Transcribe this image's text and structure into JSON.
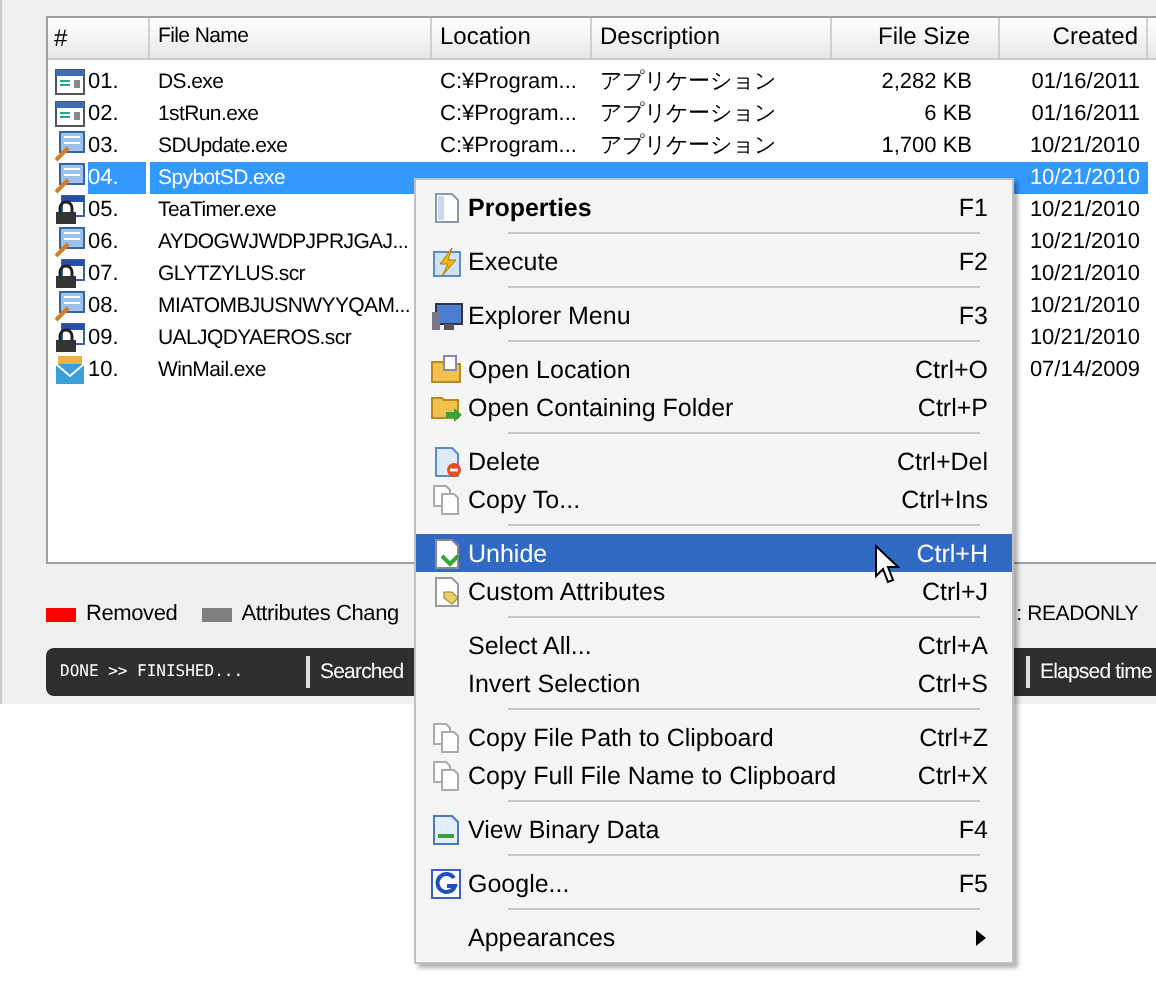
{
  "table": {
    "columns": [
      "#",
      "File Name",
      "Location",
      "Description",
      "File Size",
      "Created"
    ],
    "rows": [
      {
        "kind": "app",
        "num": "01.",
        "name": "DS.exe",
        "location": "C:¥Program...",
        "description": "アプリケーション",
        "size": "2,282 KB",
        "created": "01/16/2011",
        "selected": false
      },
      {
        "kind": "app",
        "num": "02.",
        "name": "1stRun.exe",
        "location": "C:¥Program...",
        "description": "アプリケーション",
        "size": "6 KB",
        "created": "01/16/2011",
        "selected": false
      },
      {
        "kind": "installer",
        "num": "03.",
        "name": "SDUpdate.exe",
        "location": "C:¥Program...",
        "description": "アプリケーション",
        "size": "1,700 KB",
        "created": "10/21/2010",
        "selected": false
      },
      {
        "kind": "installer",
        "num": "04.",
        "name": "SpybotSD.exe",
        "created": "10/21/2010",
        "selected": true
      },
      {
        "kind": "lock",
        "num": "05.",
        "name": "TeaTimer.exe",
        "created": "10/21/2010",
        "selected": false
      },
      {
        "kind": "installer",
        "num": "06.",
        "name": "AYDOGWJWDPJPRJGAJ...",
        "created": "10/21/2010",
        "selected": false
      },
      {
        "kind": "lock",
        "num": "07.",
        "name": "GLYTZYLUS.scr",
        "created": "10/21/2010",
        "selected": false
      },
      {
        "kind": "installer",
        "num": "08.",
        "name": "MIATOMBJUSNWYYQAM...",
        "created": "10/21/2010",
        "selected": false
      },
      {
        "kind": "lock",
        "num": "09.",
        "name": "UALJQDYAEROS.scr",
        "created": "10/21/2010",
        "selected": false
      },
      {
        "kind": "mail",
        "num": "10.",
        "name": "WinMail.exe",
        "created": "07/14/2009",
        "selected": false
      }
    ]
  },
  "legend": [
    {
      "label": "Removed",
      "color": "#ff0000"
    },
    {
      "label": "Attributes Chang",
      "color": "#808080"
    }
  ],
  "legend_right": ": READONLY",
  "status_bar": [
    "DONE >> FINISHED...",
    "Searched",
    "Elapsed time"
  ],
  "context_menu": [
    {
      "kind": "default",
      "label": "Properties",
      "shortcut": "F1",
      "selected": false
    },
    {
      "kind": "separator"
    },
    {
      "kind": "bolt",
      "label": "Execute",
      "shortcut": "F2",
      "selected": false
    },
    {
      "kind": "separator"
    },
    {
      "kind": "monitor",
      "label": "Explorer Menu",
      "shortcut": "F3",
      "selected": false
    },
    {
      "kind": "separator"
    },
    {
      "kind": "folder",
      "label": "Open Location",
      "shortcut": "Ctrl+O",
      "selected": false
    },
    {
      "kind": "folder-arrow",
      "label": "Open Containing Folder",
      "shortcut": "Ctrl+P",
      "selected": false
    },
    {
      "kind": "separator"
    },
    {
      "kind": "delete",
      "label": "Delete",
      "shortcut": "Ctrl+Del",
      "selected": false
    },
    {
      "kind": "copy",
      "label": "Copy To...",
      "shortcut": "Ctrl+Ins",
      "selected": false
    },
    {
      "kind": "separator"
    },
    {
      "kind": "unhide",
      "label": "Unhide",
      "shortcut": "Ctrl+H",
      "selected": true
    },
    {
      "kind": "tag",
      "label": "Custom Attributes",
      "shortcut": "Ctrl+J",
      "selected": false
    },
    {
      "kind": "separator"
    },
    {
      "kind": "plain",
      "label": "Select All...",
      "shortcut": "Ctrl+A",
      "selected": false
    },
    {
      "kind": "plain",
      "label": "Invert Selection",
      "shortcut": "Ctrl+S",
      "selected": false
    },
    {
      "kind": "separator"
    },
    {
      "kind": "copy",
      "label": "Copy File Path to Clipboard",
      "shortcut": "Ctrl+Z",
      "selected": false
    },
    {
      "kind": "copy",
      "label": "Copy Full File Name to Clipboard",
      "shortcut": "Ctrl+X",
      "selected": false
    },
    {
      "kind": "separator"
    },
    {
      "kind": "binary",
      "label": "View Binary Data",
      "shortcut": "F4",
      "selected": false
    },
    {
      "kind": "separator"
    },
    {
      "kind": "google",
      "label": "Google...",
      "shortcut": "F5",
      "selected": false
    },
    {
      "kind": "separator"
    },
    {
      "kind": "submenu",
      "label": "Appearances",
      "selected": false
    }
  ]
}
